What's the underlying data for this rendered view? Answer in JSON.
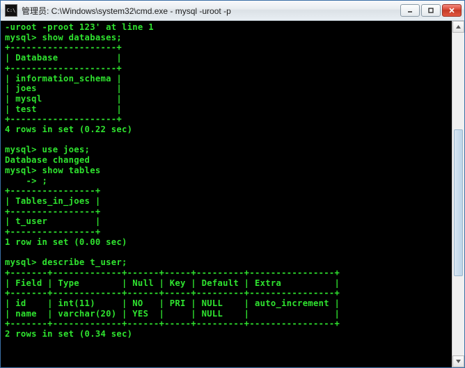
{
  "window": {
    "title_prefix": "管理员: ",
    "title_path": "C:\\Windows\\system32\\cmd.exe - mysql  -uroot -p",
    "icon_glyph": "C:\\"
  },
  "terminal": {
    "lines": [
      "-uroot -proot 123' at line 1",
      "mysql> show databases;",
      "+--------------------+",
      "| Database           |",
      "+--------------------+",
      "| information_schema |",
      "| joes               |",
      "| mysql              |",
      "| test               |",
      "+--------------------+",
      "4 rows in set (0.22 sec)",
      "",
      "mysql> use joes;",
      "Database changed",
      "mysql> show tables",
      "    -> ;",
      "+----------------+",
      "| Tables_in_joes |",
      "+----------------+",
      "| t_user         |",
      "+----------------+",
      "1 row in set (0.00 sec)",
      "",
      "mysql> describe t_user;",
      "+-------+-------------+------+-----+---------+----------------+",
      "| Field | Type        | Null | Key | Default | Extra          |",
      "+-------+-------------+------+-----+---------+----------------+",
      "| id    | int(11)     | NO   | PRI | NULL    | auto_increment |",
      "| name  | varchar(20) | YES  |     | NULL    |                |",
      "+-------+-------------+------+-----+---------+----------------+",
      "2 rows in set (0.34 sec)"
    ]
  },
  "chart_data": {
    "type": "table",
    "tables": [
      {
        "title": "show databases",
        "columns": [
          "Database"
        ],
        "rows": [
          [
            "information_schema"
          ],
          [
            "joes"
          ],
          [
            "mysql"
          ],
          [
            "test"
          ]
        ],
        "footer": "4 rows in set (0.22 sec)"
      },
      {
        "title": "show tables",
        "columns": [
          "Tables_in_joes"
        ],
        "rows": [
          [
            "t_user"
          ]
        ],
        "footer": "1 row in set (0.00 sec)"
      },
      {
        "title": "describe t_user",
        "columns": [
          "Field",
          "Type",
          "Null",
          "Key",
          "Default",
          "Extra"
        ],
        "rows": [
          [
            "id",
            "int(11)",
            "NO",
            "PRI",
            "NULL",
            "auto_increment"
          ],
          [
            "name",
            "varchar(20)",
            "YES",
            "",
            "NULL",
            ""
          ]
        ],
        "footer": "2 rows in set (0.34 sec)"
      }
    ]
  }
}
